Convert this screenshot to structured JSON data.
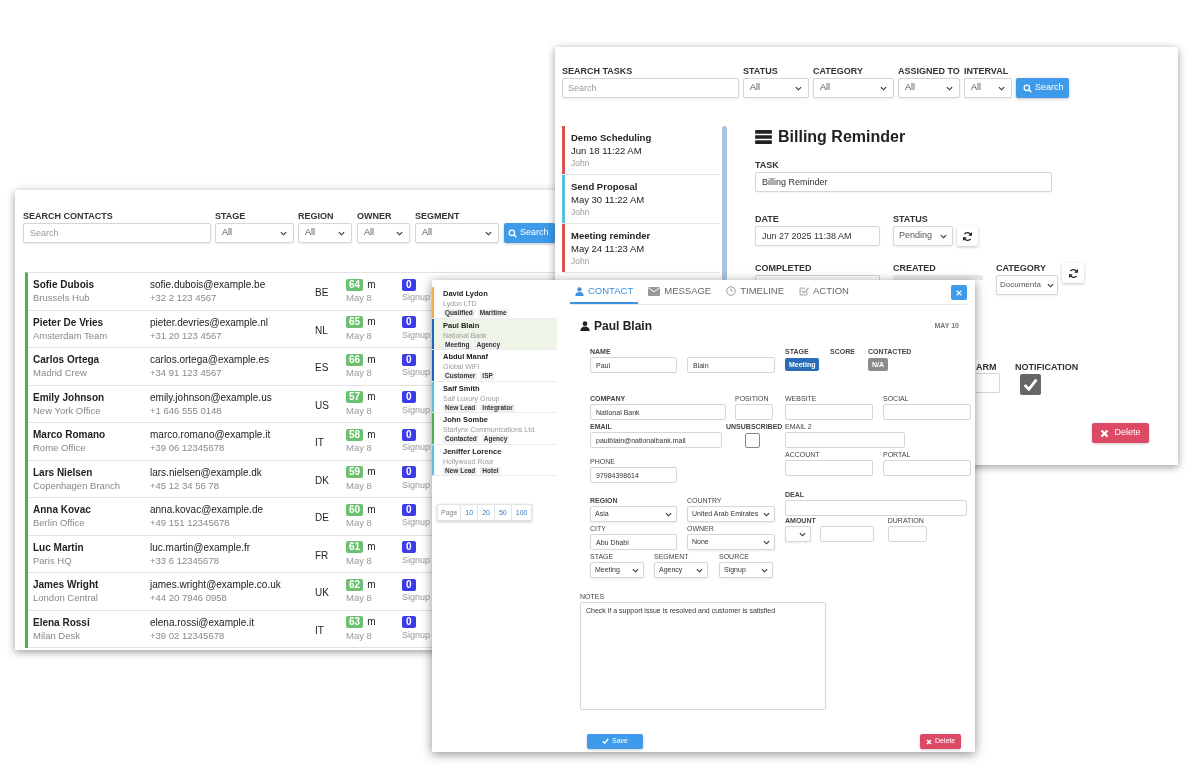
{
  "contacts_window": {
    "search": {
      "label": "SEARCH CONTACTS",
      "placeholder": "Search"
    },
    "filters": [
      {
        "label": "STAGE",
        "value": "All"
      },
      {
        "label": "REGION",
        "value": "All"
      },
      {
        "label": "OWNER",
        "value": "All"
      },
      {
        "label": "SEGMENT",
        "value": "All"
      }
    ],
    "search_button": "Search",
    "rows": [
      {
        "name": "Sofie Dubois",
        "office": "Brussels Hub",
        "email": "sofie.dubois@example.be",
        "phone": "+32 2 123 4567",
        "region": "BE",
        "score": "64",
        "unit": "m",
        "count": "0",
        "date": "May 8",
        "source": "Signup"
      },
      {
        "name": "Pieter De Vries",
        "office": "Amsterdam Team",
        "email": "pieter.devries@example.nl",
        "phone": "+31 20 123 4567",
        "region": "NL",
        "score": "65",
        "unit": "m",
        "count": "0",
        "date": "May 8",
        "source": "Signup"
      },
      {
        "name": "Carlos Ortega",
        "office": "Madrid Crew",
        "email": "carlos.ortega@example.es",
        "phone": "+34 91 123 4567",
        "region": "ES",
        "score": "66",
        "unit": "m",
        "count": "0",
        "date": "May 8",
        "source": "Signup"
      },
      {
        "name": "Emily Johnson",
        "office": "New York Office",
        "email": "emily.johnson@example.us",
        "phone": "+1 646 555 0148",
        "region": "US",
        "score": "57",
        "unit": "m",
        "count": "0",
        "date": "May 8",
        "source": "Signup"
      },
      {
        "name": "Marco Romano",
        "office": "Rome Office",
        "email": "marco.romano@example.it",
        "phone": "+39 06 12345678",
        "region": "IT",
        "score": "58",
        "unit": "m",
        "count": "0",
        "date": "May 8",
        "source": "Signup"
      },
      {
        "name": "Lars Nielsen",
        "office": "Copenhagen Branch",
        "email": "lars.nielsen@example.dk",
        "phone": "+45 12 34 56 78",
        "region": "DK",
        "score": "59",
        "unit": "m",
        "count": "0",
        "date": "May 8",
        "source": "Signup"
      },
      {
        "name": "Anna Kovac",
        "office": "Berlin Office",
        "email": "anna.kovac@example.de",
        "phone": "+49 151 12345678",
        "region": "DE",
        "score": "60",
        "unit": "m",
        "count": "0",
        "date": "May 8",
        "source": "Signup"
      },
      {
        "name": "Luc Martin",
        "office": "Paris HQ",
        "email": "luc.martin@example.fr",
        "phone": "+33 6 12345678",
        "region": "FR",
        "score": "61",
        "unit": "m",
        "count": "0",
        "date": "May 8",
        "source": "Signup"
      },
      {
        "name": "James Wright",
        "office": "London Central",
        "email": "james.wright@example.co.uk",
        "phone": "+44 20 7946 0958",
        "region": "UK",
        "score": "62",
        "unit": "m",
        "count": "0",
        "date": "May 8",
        "source": "Signup"
      },
      {
        "name": "Elena Rossi",
        "office": "Milan Desk",
        "email": "elena.rossi@example.it",
        "phone": "+39 02 12345678",
        "region": "IT",
        "score": "63",
        "unit": "m",
        "count": "0",
        "date": "May 8",
        "source": "Signup"
      }
    ]
  },
  "tasks_window": {
    "search": {
      "label": "SEARCH TASKS",
      "placeholder": "Search"
    },
    "filters": [
      {
        "label": "STATUS",
        "value": "All"
      },
      {
        "label": "CATEGORY",
        "value": "All"
      },
      {
        "label": "ASSIGNED TO",
        "value": "All"
      },
      {
        "label": "INTERVAL",
        "value": "All"
      }
    ],
    "search_button": "Search",
    "tasks": [
      {
        "title": "Demo Scheduling",
        "date": "Jun 18 11:22 AM",
        "assignee": "John",
        "color": "#d9534f"
      },
      {
        "title": "Send Proposal",
        "date": "May 30 11:22 AM",
        "assignee": "John",
        "color": "#5bc0de"
      },
      {
        "title": "Meeting reminder",
        "date": "May 24 11:23 AM",
        "assignee": "John",
        "color": "#d9534f"
      }
    ],
    "detail": {
      "title": "Billing Reminder",
      "task": {
        "label": "TASK",
        "value": "Billing Reminder"
      },
      "date": {
        "label": "DATE",
        "value": "Jun 27 2025 11:38 AM"
      },
      "status": {
        "label": "STATUS",
        "value": "Pending"
      },
      "completed": {
        "label": "COMPLETED"
      },
      "created": {
        "label": "CREATED"
      },
      "category": {
        "label": "CATEGORY",
        "value": "Documenta"
      },
      "alarm": {
        "label": "ARM"
      },
      "notification": {
        "label": "NOTIFICATION",
        "checked": true
      },
      "delete_button": "Delete"
    }
  },
  "contact_window": {
    "contacts": [
      {
        "name": "David Lydon",
        "company": "Lydon LTD",
        "tags": [
          "Qualified",
          "Maritime"
        ],
        "color": "#f0ad4e",
        "selected": false
      },
      {
        "name": "Paul Blain",
        "company": "National Bank",
        "tags": [
          "Meeting",
          "Agency"
        ],
        "color": "#1e63c4",
        "selected": true
      },
      {
        "name": "Abdul Manaf",
        "company": "Global WiFi",
        "tags": [
          "Customer",
          "ISP"
        ],
        "color": "#1e63c4",
        "selected": false
      },
      {
        "name": "Saif Smith",
        "company": "Saif Luxury Group",
        "tags": [
          "New Lead",
          "Integrator"
        ],
        "color": "#5bc0de",
        "selected": false
      },
      {
        "name": "John Sombe",
        "company": "Starlynx Communications Ltd.",
        "tags": [
          "Contacted",
          "Agency"
        ],
        "color": "#4caf50",
        "selected": false
      },
      {
        "name": "Jeniffer Lorence",
        "company": "Hollywood Rose",
        "tags": [
          "New Lead",
          "Hotel"
        ],
        "color": "#5bc0de",
        "selected": false
      }
    ],
    "pagination": {
      "label": "Page",
      "sizes": [
        "10",
        "20",
        "50",
        "100"
      ]
    },
    "tabs": [
      {
        "label": "CONTACT",
        "selected": true
      },
      {
        "label": "MESSAGE",
        "selected": false
      },
      {
        "label": "TIMELINE",
        "selected": false
      },
      {
        "label": "ACTION",
        "selected": false
      }
    ],
    "title": "Paul Blain",
    "date": "MAY 10",
    "left_rows": [
      [
        {
          "label": "NAME",
          "bold": true,
          "kind": "input",
          "value": "Paul"
        },
        {
          "kind": "input",
          "value": "Blain"
        }
      ],
      [
        {
          "label": "COMPANY",
          "bold": true,
          "kind": "input",
          "value": "National Bank"
        },
        {
          "label": "POSITION",
          "bold": false,
          "kind": "input"
        }
      ],
      [
        {
          "label": "EMAIL",
          "bold": true,
          "kind": "input",
          "value": "paulblain@nationalbank.mail"
        },
        {
          "label": "UNSUBSCRIBED",
          "bold": true,
          "kind": "checkbox",
          "checked": false
        }
      ],
      [
        {
          "label": "PHONE",
          "bold": false,
          "kind": "input",
          "value": "97984398614"
        }
      ],
      [
        {
          "label": "REGION",
          "bold": true,
          "kind": "select",
          "value": "Asia"
        },
        {
          "label": "COUNTRY",
          "bold": false,
          "kind": "select",
          "value": "United Arab Emirates"
        }
      ],
      [
        {
          "label": "CITY",
          "bold": false,
          "kind": "input",
          "value": "Abu Dhabi"
        },
        {
          "label": "OWNER",
          "bold": false,
          "kind": "select",
          "value": "None"
        }
      ],
      [
        {
          "label": "STAGE",
          "bold": false,
          "kind": "select",
          "value": "Meeting"
        },
        {
          "label": "SEGMENT",
          "bold": false,
          "kind": "select",
          "value": "Agency"
        },
        {
          "label": "SOURCE",
          "bold": false,
          "kind": "select",
          "value": "Signup"
        }
      ]
    ],
    "right_rows": [
      [
        {
          "label": "STAGE",
          "bold": true,
          "kind": "badge",
          "value": "Meeting",
          "color": "#2a6db5"
        },
        {
          "label": "SCORE",
          "bold": true
        },
        {
          "label": "CONTACTED",
          "bold": true,
          "kind": "badge",
          "value": "N/A",
          "color": "#8c8c8c"
        }
      ],
      [
        {
          "label": "WEBSITE",
          "bold": false,
          "kind": "input"
        },
        {
          "label": "SOCIAL",
          "bold": false,
          "kind": "input"
        }
      ],
      [
        {
          "label": "EMAIL 2",
          "bold": false,
          "kind": "input"
        }
      ],
      [
        {
          "label": "ACCOUNT",
          "bold": false,
          "kind": "input"
        },
        {
          "label": "PORTAL",
          "bold": false,
          "kind": "input"
        }
      ],
      [
        {
          "label": "DEAL",
          "bold": true,
          "kind": "input"
        }
      ],
      [
        {
          "label": "AMOUNT",
          "bold": true,
          "kind": "select"
        },
        {
          "kind": "input"
        },
        {
          "label": "DURATION",
          "bold": false,
          "kind": "input"
        }
      ]
    ],
    "notes": {
      "label": "NOTES",
      "value": "Check if a support issue is resolved and customer is satisfied"
    },
    "save_button": "Save",
    "delete_button": "Delete"
  }
}
